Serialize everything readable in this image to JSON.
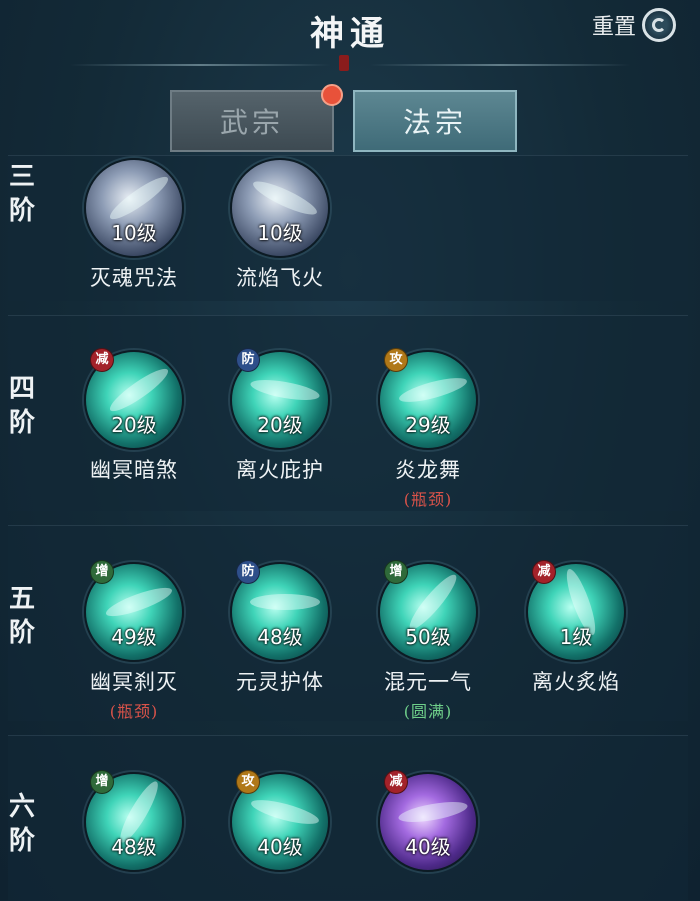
{
  "header": {
    "title": "神通",
    "reset_label": "重置",
    "reset_icon": "refresh-icon"
  },
  "tabs": [
    {
      "label": "武宗",
      "active": false
    },
    {
      "label": "法宗",
      "active": true
    }
  ],
  "colors": {
    "active_tab": "#3f6b78",
    "inactive_tab": "#3d4a52",
    "notification_dot": "#e8523a",
    "bottleneck_note": "#d9534a",
    "full_note": "#6fcf8a"
  },
  "tiers": [
    {
      "label": "三阶",
      "skills": [
        {
          "badge": "",
          "level": "10级",
          "name": "灭魂咒法",
          "note": "",
          "style": "white"
        },
        {
          "badge": "",
          "level": "10级",
          "name": "流焰飞火",
          "note": "",
          "style": "white"
        }
      ]
    },
    {
      "label": "四阶",
      "skills": [
        {
          "badge": "减",
          "level": "20级",
          "name": "幽冥暗煞",
          "note": "",
          "style": "cyan"
        },
        {
          "badge": "防",
          "level": "20级",
          "name": "离火庇护",
          "note": "",
          "style": "cyan"
        },
        {
          "badge": "攻",
          "level": "29级",
          "name": "炎龙舞",
          "note": "(瓶颈)",
          "style": "cyan"
        }
      ]
    },
    {
      "label": "五阶",
      "skills": [
        {
          "badge": "增",
          "level": "49级",
          "name": "幽冥刹灭",
          "note": "(瓶颈)",
          "style": "cyan"
        },
        {
          "badge": "防",
          "level": "48级",
          "name": "元灵护体",
          "note": "",
          "style": "cyan"
        },
        {
          "badge": "增",
          "level": "50级",
          "name": "混元一气",
          "note": "(圆满)",
          "style": "cyan"
        },
        {
          "badge": "减",
          "level": "1级",
          "name": "离火炙焰",
          "note": "",
          "style": "cyan"
        }
      ]
    },
    {
      "label": "六阶",
      "skills": [
        {
          "badge": "增",
          "level": "48级",
          "name": "",
          "note": "",
          "style": "cyan"
        },
        {
          "badge": "攻",
          "level": "40级",
          "name": "",
          "note": "",
          "style": "cyan"
        },
        {
          "badge": "减",
          "level": "40级",
          "name": "",
          "note": "",
          "style": "purple"
        }
      ]
    }
  ]
}
